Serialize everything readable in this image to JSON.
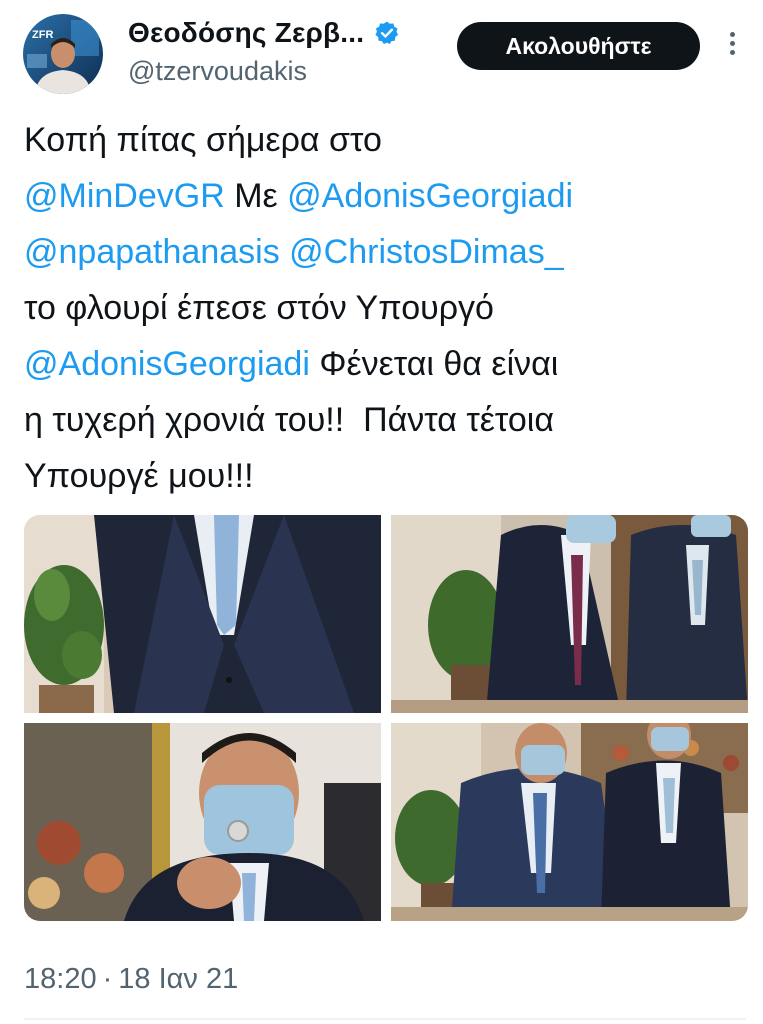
{
  "author": {
    "display_name": "Θεοδόσης Ζερβ...",
    "handle": "@tzervoudakis",
    "avatar_icon": "avatar-photo",
    "avatar_badge_text": "ZFR",
    "verified_icon": "verified-badge-icon",
    "verified_color": "#1d9bf0"
  },
  "actions": {
    "follow_label": "Ακολουθήστε",
    "more_icon": "more-vertical-icon"
  },
  "tweet": {
    "lines": [
      {
        "segments": [
          {
            "text": "Κοπή πίτας σήμερα στο",
            "mention": false
          }
        ]
      },
      {
        "segments": [
          {
            "text": "@MinDevGR",
            "mention": true
          },
          {
            "text": " Με ",
            "mention": false
          },
          {
            "text": "@AdonisGeorgiadi",
            "mention": true
          }
        ]
      },
      {
        "segments": [
          {
            "text": "@npapathanasis",
            "mention": true
          },
          {
            "text": " ",
            "mention": false
          },
          {
            "text": "@ChristosDimas_",
            "mention": true
          }
        ]
      },
      {
        "segments": [
          {
            "text": "το φλουρί έπεσε στόν Υπουργό",
            "mention": false
          }
        ]
      },
      {
        "segments": [
          {
            "text": "@AdonisGeorgiadi",
            "mention": true
          },
          {
            "text": " Φένεται θα είναι",
            "mention": false
          }
        ]
      },
      {
        "segments": [
          {
            "text": "η τυχερή χρονιά του!!  Πάντα τέτοια",
            "mention": false
          }
        ]
      },
      {
        "segments": [
          {
            "text": "Υπουργέ μου!!!",
            "mention": false
          }
        ]
      }
    ]
  },
  "media": [
    {
      "name": "photo-suit-closeup"
    },
    {
      "name": "photo-cake-cutting"
    },
    {
      "name": "photo-holding-coin"
    },
    {
      "name": "photo-two-men-table"
    }
  ],
  "meta": {
    "time": "18:20",
    "separator": "·",
    "date": "18 Ιαν 21"
  },
  "colors": {
    "text": "#0f1419",
    "secondary": "#536471",
    "link": "#1d9bf0",
    "button_bg": "#0f1419"
  }
}
